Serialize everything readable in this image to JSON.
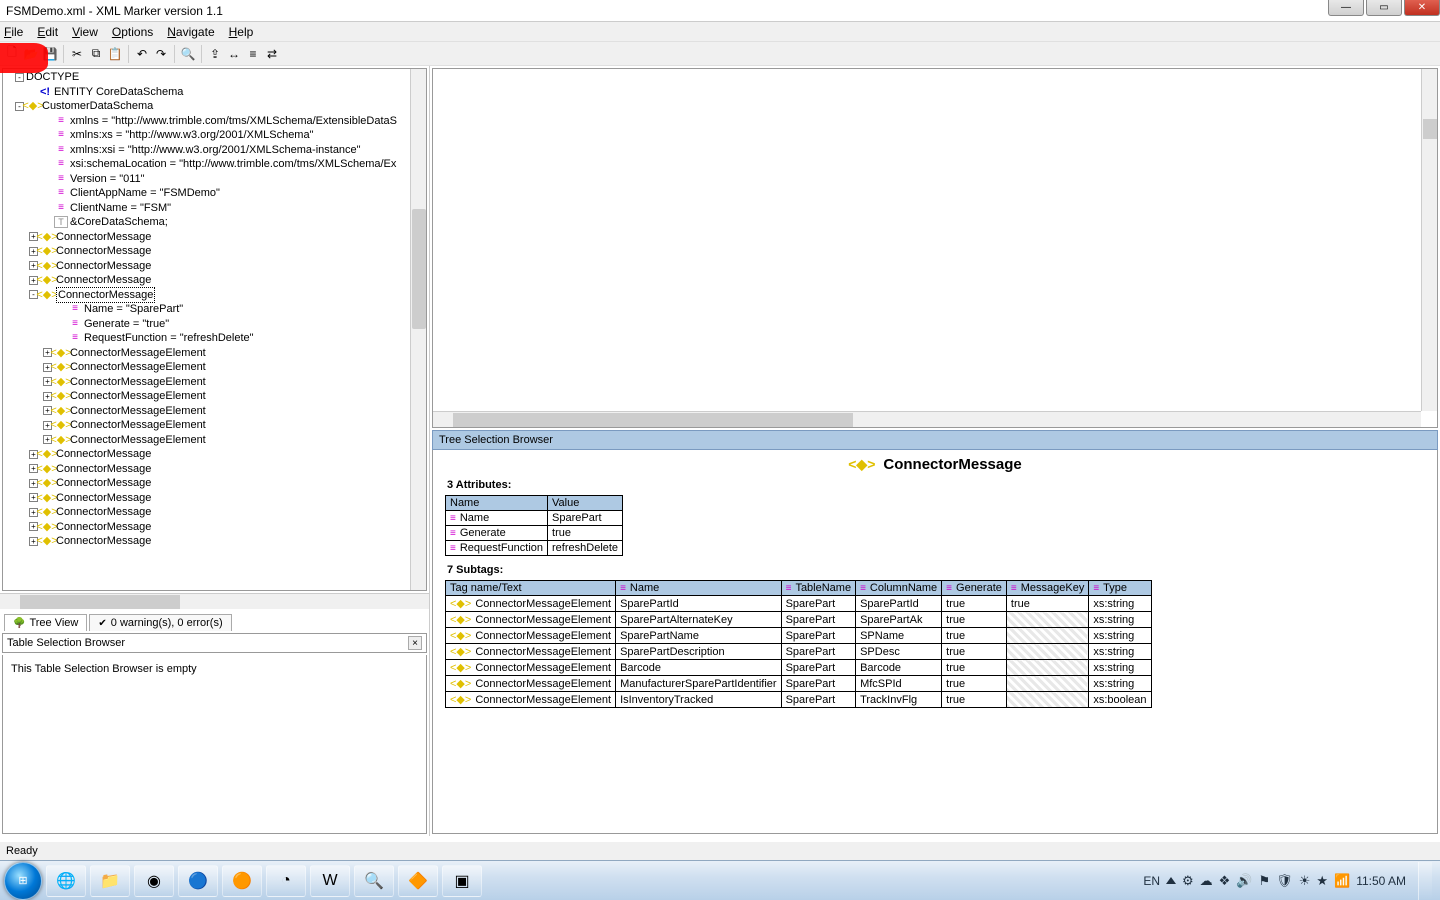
{
  "title": "FSMDemo.xml  -  XML Marker version 1.1",
  "menu": [
    "File",
    "Edit",
    "View",
    "Options",
    "Navigate",
    "Help"
  ],
  "tree": [
    {
      "ind": 12,
      "exp": "-",
      "kind": "",
      "text": "DOCTYPE"
    },
    {
      "ind": 24,
      "exp": "",
      "kind": "decl",
      "text": "ENTITY CoreDataSchema"
    },
    {
      "ind": 12,
      "exp": "-",
      "kind": "elem",
      "text": "CustomerDataSchema"
    },
    {
      "ind": 40,
      "exp": "",
      "kind": "attr",
      "text": "xmlns = \"http://www.trimble.com/tms/XMLSchema/ExtensibleDataS"
    },
    {
      "ind": 40,
      "exp": "",
      "kind": "attr",
      "text": "xmlns:xs = \"http://www.w3.org/2001/XMLSchema\""
    },
    {
      "ind": 40,
      "exp": "",
      "kind": "attr",
      "text": "xmlns:xsi = \"http://www.w3.org/2001/XMLSchema-instance\""
    },
    {
      "ind": 40,
      "exp": "",
      "kind": "attr",
      "text": "xsi:schemaLocation = \"http://www.trimble.com/tms/XMLSchema/Ex"
    },
    {
      "ind": 40,
      "exp": "",
      "kind": "attr",
      "text": "Version = \"011\""
    },
    {
      "ind": 40,
      "exp": "",
      "kind": "attr",
      "text": "ClientAppName = \"FSMDemo\""
    },
    {
      "ind": 40,
      "exp": "",
      "kind": "attr",
      "text": "ClientName = \"FSM\""
    },
    {
      "ind": 40,
      "exp": "",
      "kind": "txt",
      "text": "&CoreDataSchema;"
    },
    {
      "ind": 26,
      "exp": "+",
      "kind": "elem",
      "text": "ConnectorMessage"
    },
    {
      "ind": 26,
      "exp": "+",
      "kind": "elem",
      "text": "ConnectorMessage"
    },
    {
      "ind": 26,
      "exp": "+",
      "kind": "elem",
      "text": "ConnectorMessage"
    },
    {
      "ind": 26,
      "exp": "+",
      "kind": "elem",
      "text": "ConnectorMessage"
    },
    {
      "ind": 26,
      "exp": "-",
      "kind": "elem",
      "text": "ConnectorMessage",
      "sel": true
    },
    {
      "ind": 54,
      "exp": "",
      "kind": "attr",
      "text": "Name = \"SparePart\""
    },
    {
      "ind": 54,
      "exp": "",
      "kind": "attr",
      "text": "Generate = \"true\""
    },
    {
      "ind": 54,
      "exp": "",
      "kind": "attr",
      "text": "RequestFunction = \"refreshDelete\""
    },
    {
      "ind": 40,
      "exp": "+",
      "kind": "elem",
      "text": "ConnectorMessageElement"
    },
    {
      "ind": 40,
      "exp": "+",
      "kind": "elem",
      "text": "ConnectorMessageElement"
    },
    {
      "ind": 40,
      "exp": "+",
      "kind": "elem",
      "text": "ConnectorMessageElement"
    },
    {
      "ind": 40,
      "exp": "+",
      "kind": "elem",
      "text": "ConnectorMessageElement"
    },
    {
      "ind": 40,
      "exp": "+",
      "kind": "elem",
      "text": "ConnectorMessageElement"
    },
    {
      "ind": 40,
      "exp": "+",
      "kind": "elem",
      "text": "ConnectorMessageElement"
    },
    {
      "ind": 40,
      "exp": "+",
      "kind": "elem",
      "text": "ConnectorMessageElement"
    },
    {
      "ind": 26,
      "exp": "+",
      "kind": "elem",
      "text": "ConnectorMessage"
    },
    {
      "ind": 26,
      "exp": "+",
      "kind": "elem",
      "text": "ConnectorMessage"
    },
    {
      "ind": 26,
      "exp": "+",
      "kind": "elem",
      "text": "ConnectorMessage"
    },
    {
      "ind": 26,
      "exp": "+",
      "kind": "elem",
      "text": "ConnectorMessage"
    },
    {
      "ind": 26,
      "exp": "+",
      "kind": "elem",
      "text": "ConnectorMessage"
    },
    {
      "ind": 26,
      "exp": "+",
      "kind": "elem",
      "text": "ConnectorMessage"
    },
    {
      "ind": 26,
      "exp": "+",
      "kind": "elem",
      "text": "ConnectorMessage"
    }
  ],
  "tabs": {
    "treeview": "Tree View",
    "warnings": "0 warning(s), 0 error(s)"
  },
  "tablesel": {
    "title": "Table Selection Browser",
    "body": "This Table Selection Browser is empty"
  },
  "tsb": "Tree Selection Browser",
  "detail": {
    "title": "ConnectorMessage",
    "attrlabel": "3 Attributes:",
    "attrhead": [
      "Name",
      "Value"
    ],
    "attrs": [
      {
        "n": "Name",
        "v": "SparePart"
      },
      {
        "n": "Generate",
        "v": "true"
      },
      {
        "n": "RequestFunction",
        "v": "refreshDelete"
      }
    ],
    "sublabel": "7 Subtags:",
    "subhead": [
      "Tag name/Text",
      "Name",
      "TableName",
      "ColumnName",
      "Generate",
      "MessageKey",
      "Type"
    ],
    "subs": [
      {
        "tag": "ConnectorMessageElement",
        "n": "SparePartId",
        "t": "SparePart",
        "c": "SparePartId",
        "g": "true",
        "m": "true",
        "ty": "xs:string"
      },
      {
        "tag": "ConnectorMessageElement",
        "n": "SparePartAlternateKey",
        "t": "SparePart",
        "c": "SparePartAk",
        "g": "true",
        "m": "",
        "ty": "xs:string"
      },
      {
        "tag": "ConnectorMessageElement",
        "n": "SparePartName",
        "t": "SparePart",
        "c": "SPName",
        "g": "true",
        "m": "",
        "ty": "xs:string"
      },
      {
        "tag": "ConnectorMessageElement",
        "n": "SparePartDescription",
        "t": "SparePart",
        "c": "SPDesc",
        "g": "true",
        "m": "",
        "ty": "xs:string"
      },
      {
        "tag": "ConnectorMessageElement",
        "n": "Barcode",
        "t": "SparePart",
        "c": "Barcode",
        "g": "true",
        "m": "",
        "ty": "xs:string"
      },
      {
        "tag": "ConnectorMessageElement",
        "n": "ManufacturerSparePartIdentifier",
        "t": "SparePart",
        "c": "MfcSPId",
        "g": "true",
        "m": "",
        "ty": "xs:string"
      },
      {
        "tag": "ConnectorMessageElement",
        "n": "IsInventoryTracked",
        "t": "SparePart",
        "c": "TrackInvFlg",
        "g": "true",
        "m": "",
        "ty": "xs:boolean"
      }
    ]
  },
  "status": "Ready",
  "tray": {
    "lang": "EN",
    "clock": "11:50 AM"
  }
}
